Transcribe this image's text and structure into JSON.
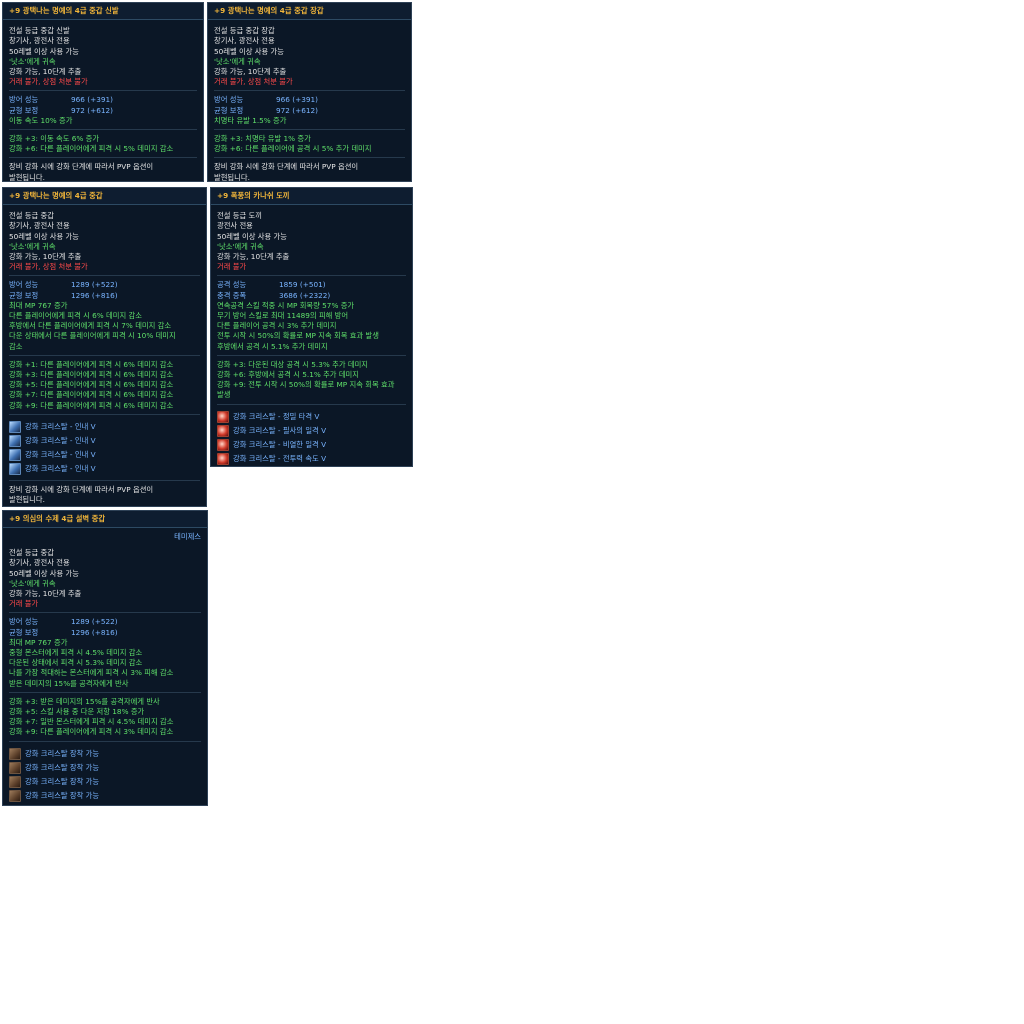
{
  "tooltips": {
    "shoes": {
      "title": "+9 광택나는 명예의 4급 중갑 신발",
      "lines": [
        {
          "t": "전설 등급 중갑 신발",
          "c": "w"
        },
        {
          "t": "창기사, 광전사 전용",
          "c": "w"
        },
        {
          "t": "50레벨 이상 사용 가능",
          "c": "w"
        },
        {
          "t": "'낫소'에게 귀속",
          "c": "g"
        },
        {
          "t": "강화 가능, 10단계 추출",
          "c": "w"
        },
        {
          "t": "거래 불가, 상점 처분 불가",
          "c": "r"
        }
      ],
      "stats": [
        {
          "k": "방어 성능",
          "v": "966 (+391)"
        },
        {
          "k": "균형 보정",
          "v": "972 (+612)"
        }
      ],
      "stat_extra": [
        "이동 속도 10% 증가"
      ],
      "enchants": [
        "강화 +3: 이동 속도 6% 증가",
        "강화 +6: 다른 플레이어에게 피격 시 5% 데미지 감소"
      ],
      "pvp_note": [
        "장비 강화 시에 강화 단계에 따라서 PVP 옵션이",
        "발현됩니다."
      ]
    },
    "gloves": {
      "title": "+9 광택나는 명예의 4급 중갑 장갑",
      "lines": [
        {
          "t": "전설 등급 중갑 장갑",
          "c": "w"
        },
        {
          "t": "창기사, 광전사 전용",
          "c": "w"
        },
        {
          "t": "50레벨 이상 사용 가능",
          "c": "w"
        },
        {
          "t": "'낫소'에게 귀속",
          "c": "g"
        },
        {
          "t": "강화 가능, 10단계 추출",
          "c": "w"
        },
        {
          "t": "거래 불가, 상점 처분 불가",
          "c": "r"
        }
      ],
      "stats": [
        {
          "k": "방어 성능",
          "v": "966 (+391)"
        },
        {
          "k": "균형 보정",
          "v": "972 (+612)"
        }
      ],
      "stat_extra": [
        "치명타 유발 1.5% 증가"
      ],
      "enchants": [
        "강화 +3: 치명타 유발 1% 증가",
        "강화 +6: 다른 플레이어에 공격 시 5% 추가 데미지"
      ],
      "pvp_note": [
        "장비 강화 시에 강화 단계에 따라서 PVP 옵션이",
        "발현됩니다."
      ]
    },
    "armor": {
      "title": "+9 광택나는 명예의 4급 중갑",
      "lines": [
        {
          "t": "전설 등급 중갑",
          "c": "w"
        },
        {
          "t": "창기사, 광전사 전용",
          "c": "w"
        },
        {
          "t": "50레벨 이상 사용 가능",
          "c": "w"
        },
        {
          "t": "'낫소'에게 귀속",
          "c": "g"
        },
        {
          "t": "강화 가능, 10단계 추출",
          "c": "w"
        },
        {
          "t": "거래 불가, 상점 처분 불가",
          "c": "r"
        }
      ],
      "stats": [
        {
          "k": "방어 성능",
          "v": "1289 (+522)"
        },
        {
          "k": "균형 보정",
          "v": "1296 (+816)"
        }
      ],
      "stat_extra": [
        "최대 MP 767 증가",
        "다른 플레이어에게 피격 시 6% 데미지 감소",
        "후방에서 다른 플레이어에게 피격 시 7% 데미지 감소",
        "다운 상태에서 다른 플레이어에게 피격 시 10% 데미지",
        "감소"
      ],
      "enchants": [
        "강화 +1: 다른 플레이어에게 피격 시 6% 데미지 감소",
        "강화 +3: 다른 플레이어에게 피격 시 6% 데미지 감소",
        "강화 +5: 다른 플레이어에게 피격 시 6% 데미지 감소",
        "강화 +7: 다른 플레이어에게 피격 시 6% 데미지 감소",
        "강화 +9: 다른 플레이어에게 피격 시 6% 데미지 감소"
      ],
      "crystals": [
        "강화 크리스탈 - 인내 V",
        "강화 크리스탈 - 인내 V",
        "강화 크리스탈 - 인내 V",
        "강화 크리스탈 - 인내 V"
      ],
      "pvp_note": [
        "장비 강화 시에 강화 단계에 따라서 PVP 옵션이",
        "발현됩니다."
      ]
    },
    "axe": {
      "title": "+9 폭풍의 카나쉬 도끼",
      "lines": [
        {
          "t": "전설 등급 도끼",
          "c": "w"
        },
        {
          "t": "광전사 전용",
          "c": "w"
        },
        {
          "t": "50레벨 이상 사용 가능",
          "c": "w"
        },
        {
          "t": "'낫소'에게 귀속",
          "c": "g"
        },
        {
          "t": "강화 가능, 10단계 추출",
          "c": "w"
        },
        {
          "t": "거래 불가",
          "c": "r"
        }
      ],
      "stats": [
        {
          "k": "공격 성능",
          "v": "1859 (+501)"
        },
        {
          "k": "충격 증폭",
          "v": "3686 (+2322)"
        }
      ],
      "stat_extra": [
        "연속공격 스킬 적중 시 MP 회복량 57% 증가",
        "무기 방어 스킬로 최대 11489의 피해 방어",
        "다른 플레이어 공격 시 3% 추가 데미지",
        "전투 시작 시 50%의 확률로 MP 지속 회복 효과 발생",
        "후방에서 공격 시 5.1% 추가 데미지"
      ],
      "enchants": [
        "강화 +3: 다운된 대상 공격 시 5.3% 추가 데미지",
        "강화 +6: 후방에서 공격 시 5.1% 추가 데미지",
        "강화 +9: 전투 시작 시 50%의 확률로 MP 지속 회복 효과",
        "발생"
      ],
      "crystals": [
        "강화 크리스탈 - 정밀 타격 V",
        "강화 크리스탈 - 필사의 일격 V",
        "강화 크리스탈 - 비열한 일격 V",
        "강화 크리스탈 - 전투력 속도 V"
      ]
    },
    "belt": {
      "title": "+9 의심의 수제 4급 설벽 중갑",
      "side_label": "테미제스",
      "lines": [
        {
          "t": "전설 등급 중갑",
          "c": "w"
        },
        {
          "t": "창기사, 광전사 전용",
          "c": "w"
        },
        {
          "t": "50레벨 이상 사용 가능",
          "c": "w"
        },
        {
          "t": "'낫소'에게 귀속",
          "c": "g"
        },
        {
          "t": "강화 가능, 10단계 추출",
          "c": "w"
        },
        {
          "t": "거래 불가",
          "c": "r"
        }
      ],
      "stats": [
        {
          "k": "방어 성능",
          "v": "1289 (+522)"
        },
        {
          "k": "균형 보정",
          "v": "1296 (+816)"
        }
      ],
      "stat_extra": [
        "최대 MP 767 증가",
        "중형 몬스터에게 피격 시 4.5% 데미지 감소",
        "다운된 상태에서 피격 시 5.3% 데미지 감소",
        "나를 가장 적대하는 몬스터에게 피격 시 3% 피해 감소",
        "받은 데미지의 15%를 공격자에게 반사"
      ],
      "enchants": [
        "강화 +3: 받은 데미지의 15%를 공격자에게 반사",
        "강화 +5: 스킬 사용 중 다운 저항 18% 증가",
        "강화 +7: 일반 몬스터에게 피격 시 4.5% 데미지 감소",
        "강화 +9: 다른 플레이어에게 피격 시 3% 데미지 감소"
      ],
      "crystals": [
        "강화 크리스탈 장착 가능",
        "강화 크리스탈 장착 가능",
        "강화 크리스탈 장착 가능",
        "강화 크리스탈 장착 가능"
      ]
    }
  },
  "icons": {
    "armor_crystal": "crystal-blue-icon",
    "axe_crystal": "crystal-red-icon",
    "belt_crystal": "crystal-slot-icon"
  },
  "colors": {
    "title": "#f2b63a",
    "green": "#5fe06a",
    "red": "#ff4a4a",
    "blue": "#79b4ff",
    "panel": "#0b1726"
  }
}
